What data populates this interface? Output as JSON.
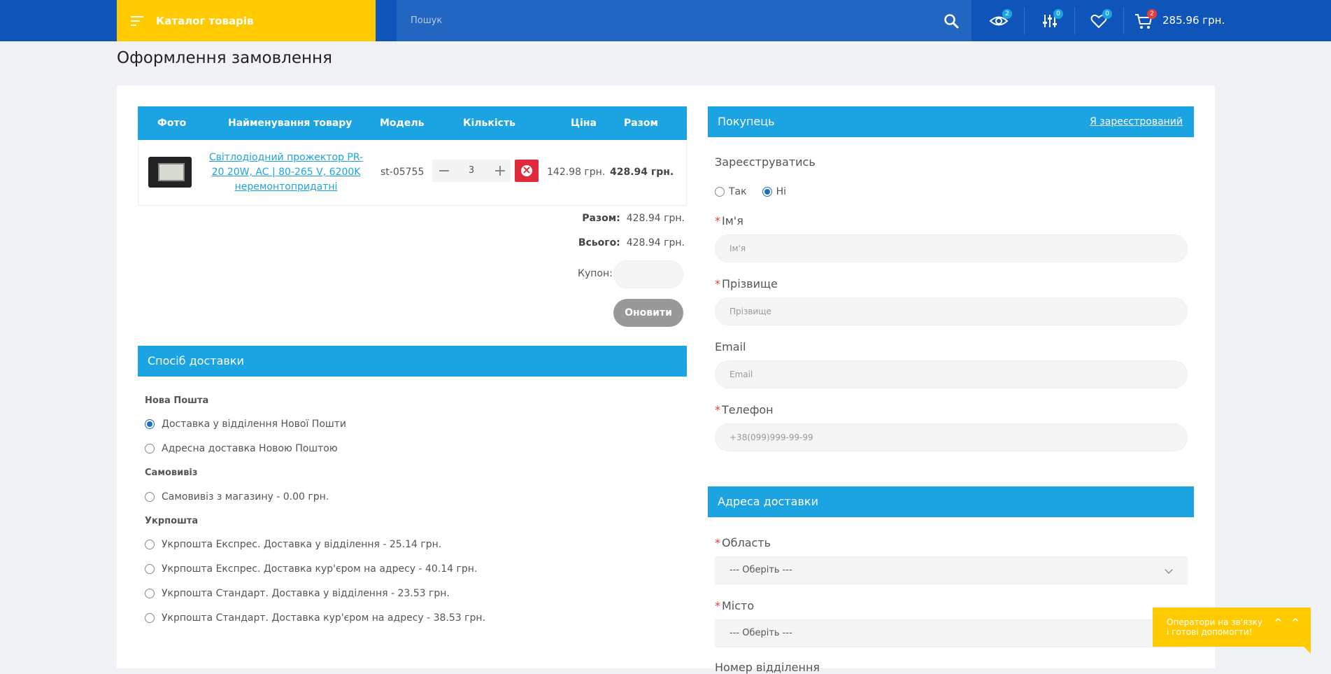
{
  "header": {
    "catalog_label": "Каталог товарів",
    "search_placeholder": "Пошук",
    "viewed_count": "2",
    "compare_count": "0",
    "wishlist_count": "0",
    "cart_count": "2",
    "cart_total": "285.96 грн."
  },
  "page": {
    "title": "Оформлення замовлення"
  },
  "cart": {
    "columns": [
      "Фото",
      "Найменування товару",
      "Модель",
      "Кількість",
      "Ціна",
      "Разом"
    ],
    "items": [
      {
        "name": "Світлодіодний прожектор PR-20 20W, AC | 80-265 V, 6200K неремонтопридатні",
        "model": "st-05755",
        "qty": "3",
        "price": "142.98 грн.",
        "total": "428.94 грн."
      }
    ],
    "subtotal_label": "Разом:",
    "subtotal_value": "428.94 грн.",
    "total_label": "Всього:",
    "total_value": "428.94 грн.",
    "coupon_label": "Купон:",
    "update_label": "Оновити"
  },
  "shipping": {
    "title": "Спосіб доставки",
    "groups": [
      {
        "name": "Нова Пошта",
        "options": [
          {
            "label": "Доставка у відділення Нової Пошти",
            "selected": true
          },
          {
            "label": "Адресна доставка Новою Поштою",
            "selected": false
          }
        ]
      },
      {
        "name": "Самовивіз",
        "options": [
          {
            "label": "Самовивіз з магазину - 0.00 грн.",
            "selected": false
          }
        ]
      },
      {
        "name": "Укрпошта",
        "options": [
          {
            "label": "Укрпошта Експрес. Доставка у відділення - 25.14 грн.",
            "selected": false
          },
          {
            "label": "Укрпошта Експрес. Доставка кур'єром на адресу - 40.14 грн.",
            "selected": false
          },
          {
            "label": "Укрпошта Стандарт. Доставка у відділення - 23.53 грн.",
            "selected": false
          },
          {
            "label": "Укрпошта Стандарт. Доставка кур'єром на адресу - 38.53 грн.",
            "selected": false
          }
        ]
      }
    ]
  },
  "buyer": {
    "title": "Покупець",
    "login_link": "Я зареєстрований",
    "register_label": "Зареєструватись",
    "yes_label": "Так",
    "no_label": "Ні",
    "first_name_label": "Ім'я",
    "first_name_placeholder": "Ім'я",
    "last_name_label": "Прізвище",
    "last_name_placeholder": "Прізвище",
    "email_label": "Email",
    "email_placeholder": "Email",
    "phone_label": "Телефон",
    "phone_placeholder": "+38(099)999-99-99"
  },
  "address": {
    "title": "Адреса доставки",
    "region_label": "Область",
    "region_value": "--- Оберіть ---",
    "city_label": "Місто",
    "city_value": "--- Оберіть ---",
    "branch_label": "Номер відділення"
  },
  "chat": {
    "text": "Оператори на зв'язку і готові допомогти!",
    "arrows": "^ ^"
  },
  "colors": {
    "header_blue": "#0f54b8",
    "accent_yellow": "#ffcb00",
    "section_blue": "#1ca4e2",
    "delete_red": "#e0293a"
  }
}
